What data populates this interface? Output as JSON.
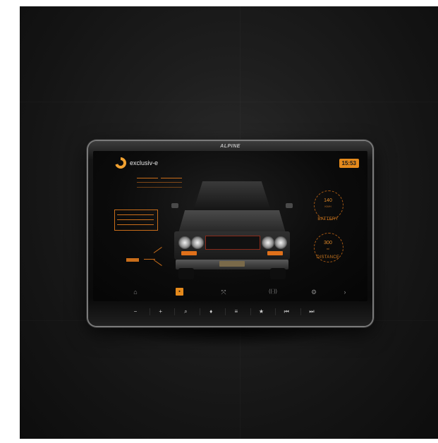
{
  "device": {
    "brand": "ALPINE"
  },
  "app": {
    "logo_text": "exclusiv-e",
    "clock": "15:53"
  },
  "gauges": {
    "battery": {
      "value": "140",
      "unit": "KWH",
      "label": "BATTERY"
    },
    "distance": {
      "value": "300",
      "unit": "mi",
      "label": "DISTANCE"
    }
  },
  "nav": [
    {
      "icon": "seat-icon",
      "glyph": "⌂"
    },
    {
      "icon": "car-icon",
      "glyph": "▪"
    },
    {
      "icon": "expand-icon",
      "glyph": "⤧"
    },
    {
      "icon": "radio-icon",
      "glyph": "((·))"
    },
    {
      "icon": "settings-icon",
      "glyph": "⚙"
    },
    {
      "icon": "next-icon",
      "glyph": "›"
    }
  ],
  "hardware_buttons": [
    {
      "icon": "volume-down-icon",
      "glyph": "−"
    },
    {
      "icon": "volume-up-icon",
      "glyph": "+"
    },
    {
      "icon": "search-icon",
      "glyph": "⌕"
    },
    {
      "icon": "mic-icon",
      "glyph": "♦"
    },
    {
      "icon": "menu-icon",
      "glyph": "≡"
    },
    {
      "icon": "favorite-icon",
      "glyph": "★"
    },
    {
      "icon": "prev-track-icon",
      "glyph": "⏮"
    },
    {
      "icon": "next-track-icon",
      "glyph": "⏭"
    }
  ],
  "colors": {
    "accent": "#e58a1c",
    "accent_dim": "#c96d1a",
    "screen_bg": "#0b0b0b"
  }
}
